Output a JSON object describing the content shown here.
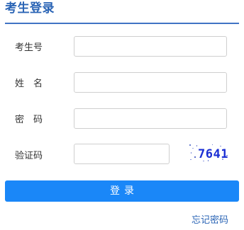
{
  "header": {
    "title": "考生登录"
  },
  "form": {
    "candidate_number_label": "考生号",
    "candidate_number_value": "",
    "name_label": "姓　名",
    "name_value": "",
    "password_label": "密　码",
    "password_value": "",
    "captcha_label": "验证码",
    "captcha_value": "",
    "captcha_text": "7641"
  },
  "actions": {
    "login_label": "登录",
    "forgot_password_label": "忘记密码"
  },
  "colors": {
    "brand_blue": "#2a64b5",
    "button_blue": "#1a87f8",
    "captcha_text": "#1b2fd4"
  }
}
